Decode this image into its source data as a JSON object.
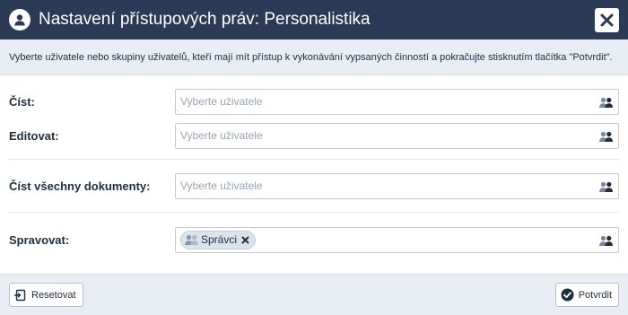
{
  "dialog": {
    "title": "Nastavení přístupových práv: Personalistika",
    "info": "Vyberte uživatele nebo skupiny uživatelů, kteří mají mít přístup k vykonávání vypsaných činností a pokračujte stisknutím tlačítka \"Potvrdit\"."
  },
  "fields": {
    "read": {
      "label": "Číst:",
      "placeholder": "Vyberte uživatele"
    },
    "edit": {
      "label": "Editovat:",
      "placeholder": "Vyberte uživatele"
    },
    "read_all": {
      "label": "Číst všechny dokumenty:",
      "placeholder": "Vyberte uživatele"
    },
    "manage": {
      "label": "Spravovat:",
      "tags": [
        {
          "label": "Správci"
        }
      ]
    }
  },
  "footer": {
    "reset_label": "Resetovat",
    "confirm_label": "Potvrdit"
  },
  "icons": {
    "header": "user-circle-icon",
    "close": "close-icon",
    "picker": "user-group-icon",
    "reset": "reset-icon",
    "confirm": "check-circle-icon"
  },
  "colors": {
    "header_bg": "#2b3a55",
    "panel_bg": "#e9eef5"
  }
}
